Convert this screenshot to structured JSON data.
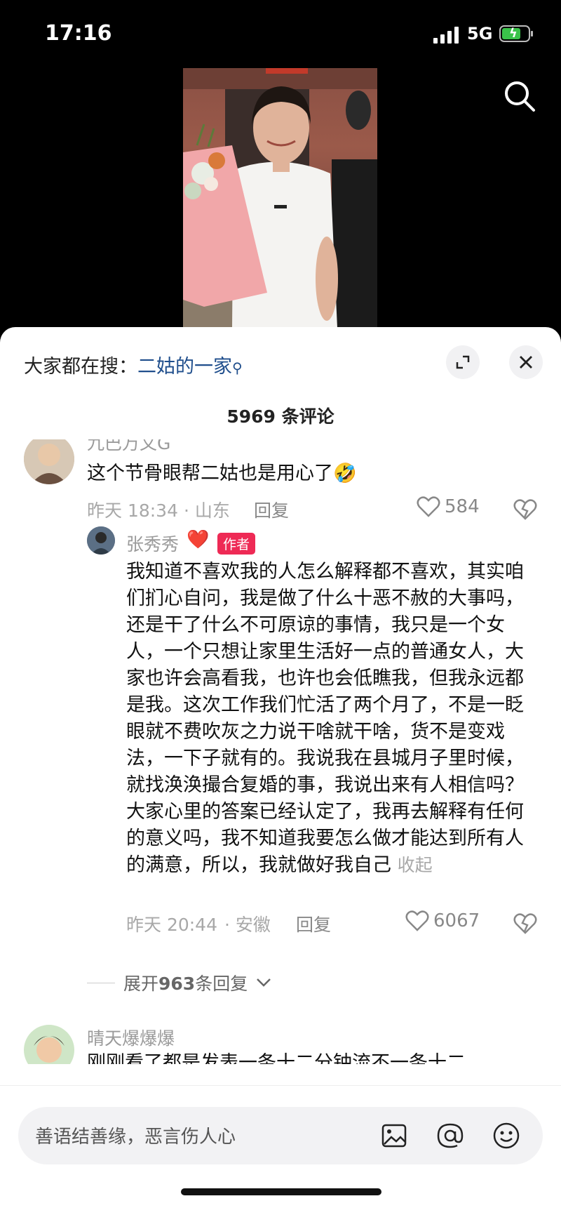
{
  "status_bar": {
    "time": "17:16",
    "network": "5G"
  },
  "hot_search": {
    "prefix": "大家都在搜：",
    "keyword": "二姑的一家"
  },
  "comments_title": "5969 条评论",
  "partial_name": "九巴万文G",
  "comment1": {
    "text": "这个节骨眼帮二姑也是用心了🤣",
    "time": "昨天 18:34",
    "location": "· 山东",
    "reply_label": "回复",
    "likes": "584"
  },
  "reply1": {
    "name": "张秀秀",
    "heart": "❤️",
    "badge": "作者",
    "text": "我知道不喜欢我的人怎么解释都不喜欢，其实咱们扪心自问，我是做了什么十恶不赦的大事吗，还是干了什么不可原谅的事情，我只是一个女人，一个只想让家里生活好一点的普通女人，大家也许会高看我，也许也会低瞧我，但我永远都是我。这次工作我们忙活了两个月了，不是一眨眼就不费吹灰之力说干啥就干啥，货不是变戏法，一下子就有的。我说我在县城月子里时候，就找涣涣撮合复婚的事，我说出来有人相信吗？ 大家心里的答案已经认定了，我再去解释有任何的意义吗，我不知道我要怎么做才能达到所有人的满意，所以，我就做好我自己",
    "fold": "收起",
    "time": "昨天 20:44",
    "location": "· 安徽",
    "reply_label": "回复",
    "likes": "6067"
  },
  "expand_replies": {
    "prefix": "展开",
    "count": "963",
    "suffix": "条回复"
  },
  "comment2": {
    "name": "晴天爆爆爆",
    "text": "刚刚看了都是发表一条十二分钟流不一条十二"
  },
  "input": {
    "placeholder": "善语结善缘，恶言伤人心"
  },
  "icons": [
    "search-icon",
    "expand-icon",
    "close-icon",
    "heart-outline-icon",
    "dislike-heart-icon",
    "chevron-down-icon",
    "image-icon",
    "at-icon",
    "emoji-icon"
  ],
  "colors": {
    "accent": "#ee2a55",
    "link": "#1f4e8c"
  }
}
